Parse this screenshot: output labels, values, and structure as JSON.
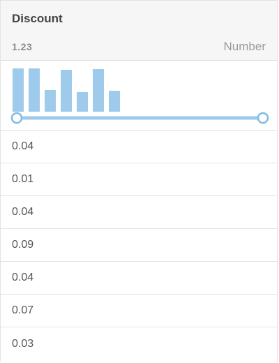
{
  "column": {
    "title": "Discount",
    "type_icon": "1.23",
    "type_label": "Number"
  },
  "histogram": {
    "bar_heights": [
      1.0,
      1.0,
      0.5,
      0.97,
      0.45,
      0.98,
      0.48
    ],
    "color": "#9ecbec",
    "range_low_handle": "range-min",
    "range_high_handle": "range-max",
    "handle_stroke": "#7fbbe6"
  },
  "rows": [
    {
      "value": "0.04"
    },
    {
      "value": "0.01"
    },
    {
      "value": "0.04"
    },
    {
      "value": "0.09"
    },
    {
      "value": "0.04"
    },
    {
      "value": "0.07"
    },
    {
      "value": "0.03"
    }
  ]
}
